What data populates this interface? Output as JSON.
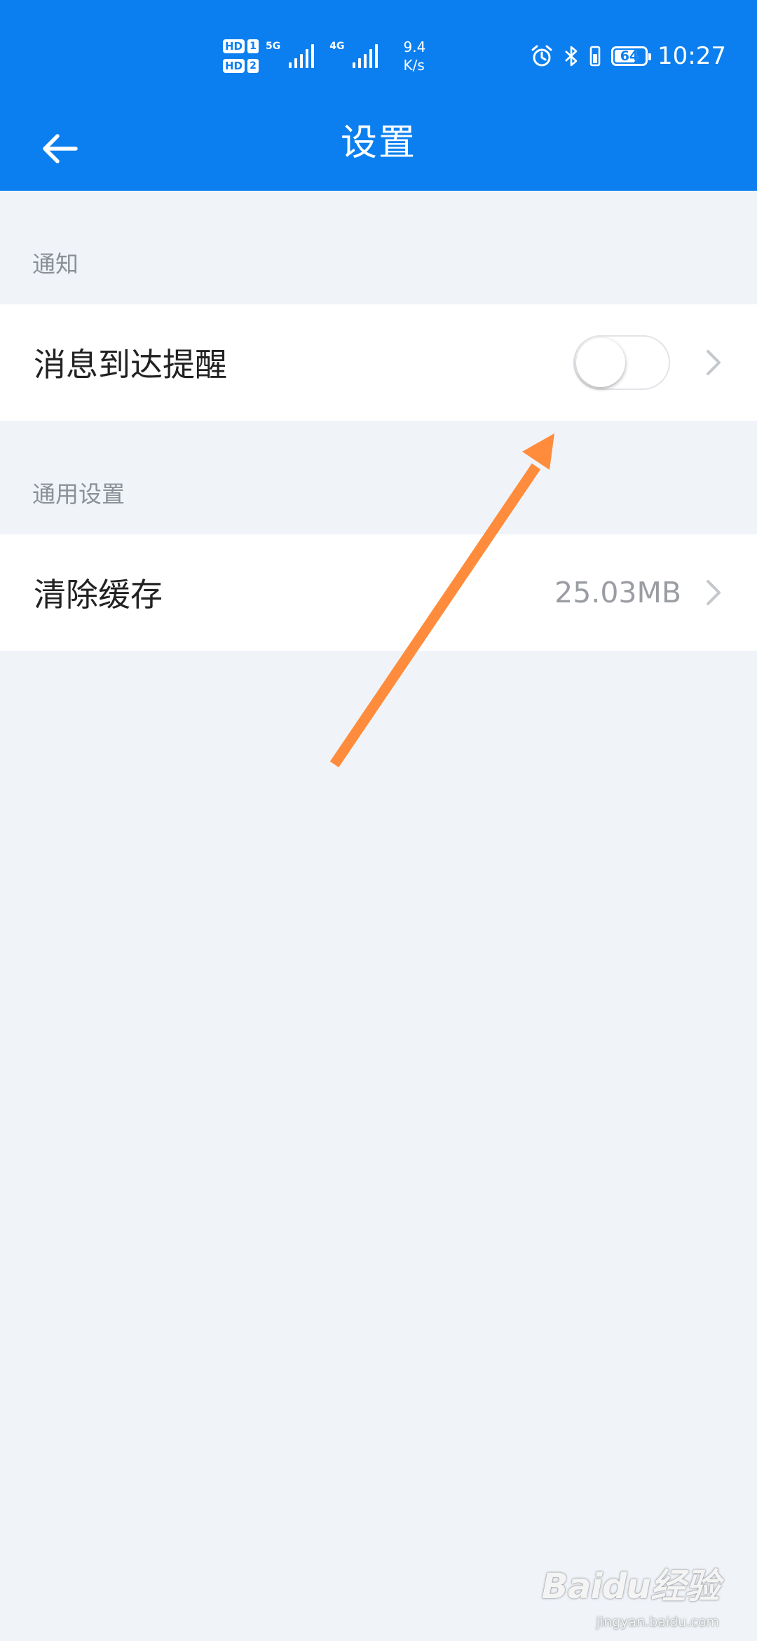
{
  "status_bar": {
    "sim1": "HD",
    "sim1_num": "1",
    "sim2": "HD",
    "sim2_num": "2",
    "network1": "5G",
    "network2": "4G",
    "speed_value": "9.4",
    "speed_unit": "K/s",
    "battery_level": "64",
    "time": "10:27"
  },
  "navbar": {
    "back_icon": "arrow-left-icon",
    "title": "设置"
  },
  "sections": [
    {
      "header": "通知",
      "items": [
        {
          "label": "消息到达提醒",
          "control": "toggle",
          "toggle_on": false
        }
      ]
    },
    {
      "header": "通用设置",
      "items": [
        {
          "label": "清除缓存",
          "value": "25.03MB"
        }
      ]
    }
  ],
  "colors": {
    "header_bg": "#0b7fef",
    "page_bg": "#f0f4f9",
    "annotation_arrow": "#ff8c3c"
  },
  "watermark": {
    "brand": "Baidu经验",
    "url": "jingyan.baidu.com"
  }
}
